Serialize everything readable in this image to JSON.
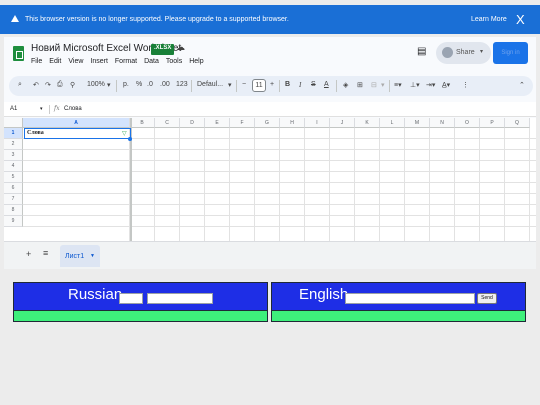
{
  "banner": {
    "message": "This browser version is no longer supported. Please upgrade to a supported browser.",
    "learn_more": "Learn More",
    "close": "X"
  },
  "header": {
    "title": "Новий Microsoft Excel Worksheet",
    "badge": ".XLSX",
    "menu": [
      "File",
      "Edit",
      "View",
      "Insert",
      "Format",
      "Data",
      "Tools",
      "Help"
    ],
    "share_label": "Share",
    "signin_label": "Sign in"
  },
  "toolbar": {
    "zoom": "100%",
    "currency": "р.",
    "percent": "%",
    "dec_decrease": ".0",
    "dec_increase": ".00",
    "number_format": "123",
    "font": "Defaul...",
    "font_size": "11"
  },
  "formula_bar": {
    "cell_ref": "A1",
    "fx": "fx",
    "value": "Слова"
  },
  "grid": {
    "columns": [
      "A",
      "B",
      "C",
      "D",
      "E",
      "F",
      "G",
      "H",
      "I",
      "J",
      "K",
      "L",
      "M",
      "N",
      "O",
      "P",
      "Q"
    ],
    "rows": [
      "1",
      "2",
      "3",
      "4",
      "5",
      "6",
      "7",
      "8",
      "9"
    ],
    "a1_value": "Слова"
  },
  "sheets": {
    "add": "+",
    "all": "≡",
    "active_tab": "Лист1"
  },
  "translator": {
    "left_title": "Russian",
    "right_title": "English",
    "send_label": "Send"
  }
}
